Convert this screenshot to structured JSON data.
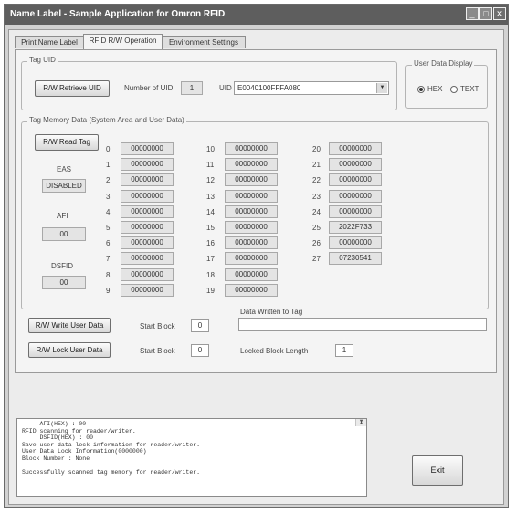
{
  "window": {
    "title": "Name Label - Sample Application for Omron RFID",
    "minimize": "_",
    "maximize": "□",
    "close": "✕"
  },
  "tabs": [
    "Print Name Label",
    "RFID R/W Operation",
    "Environment Settings"
  ],
  "tag_uid": {
    "group_title": "Tag UID",
    "retrieve_button": "R/W Retrieve UID",
    "number_of_uid_label": "Number of UID",
    "number_of_uid": "1",
    "uid_label": "UID",
    "uid_value": "E0040100FFFA080",
    "dropdown_arrow": "▼"
  },
  "display": {
    "group_title": "User Data Display",
    "options": [
      "HEX",
      "TEXT"
    ],
    "selected": "HEX"
  },
  "memory": {
    "group_title": "Tag Memory Data (System Area and User Data)",
    "read_button": "R/W Read Tag",
    "eas_label": "EAS",
    "eas_value": "DISABLED",
    "afi_label": "AFI",
    "afi_value": "00",
    "dsfid_label": "DSFID",
    "dsfid_value": "00",
    "blocks": [
      {
        "n": "0",
        "v": "00000000"
      },
      {
        "n": "1",
        "v": "00000000"
      },
      {
        "n": "2",
        "v": "00000000"
      },
      {
        "n": "3",
        "v": "00000000"
      },
      {
        "n": "4",
        "v": "00000000"
      },
      {
        "n": "5",
        "v": "00000000"
      },
      {
        "n": "6",
        "v": "00000000"
      },
      {
        "n": "7",
        "v": "00000000"
      },
      {
        "n": "8",
        "v": "00000000"
      },
      {
        "n": "9",
        "v": "00000000"
      },
      {
        "n": "10",
        "v": "00000000"
      },
      {
        "n": "11",
        "v": "00000000"
      },
      {
        "n": "12",
        "v": "00000000"
      },
      {
        "n": "13",
        "v": "00000000"
      },
      {
        "n": "14",
        "v": "00000000"
      },
      {
        "n": "15",
        "v": "00000000"
      },
      {
        "n": "16",
        "v": "00000000"
      },
      {
        "n": "17",
        "v": "00000000"
      },
      {
        "n": "18",
        "v": "00000000"
      },
      {
        "n": "19",
        "v": "00000000"
      },
      {
        "n": "20",
        "v": "00000000"
      },
      {
        "n": "21",
        "v": "00000000"
      },
      {
        "n": "22",
        "v": "00000000"
      },
      {
        "n": "23",
        "v": "00000000"
      },
      {
        "n": "24",
        "v": "00000000"
      },
      {
        "n": "25",
        "v": "2022F733"
      },
      {
        "n": "26",
        "v": "00000000"
      },
      {
        "n": "27",
        "v": "07230541"
      }
    ]
  },
  "write": {
    "write_button": "R/W Write User Data",
    "start_block_label": "Start Block",
    "start_block": "0",
    "data_label": "Data Written to Tag",
    "data_value": ""
  },
  "lock": {
    "lock_button": "R/W Lock User Data",
    "start_block_label": "Start Block",
    "start_block": "0",
    "length_label": "Locked Block Length",
    "length": "1"
  },
  "log": {
    "lines": [
      "     AFI(HEX) : 00",
      "RFID scanning for reader/writer.",
      "     DSFID(HEX) : 00",
      "Save user data lock information for reader/writer.",
      "User Data Lock Information(0000000)",
      "Block Number : None",
      "",
      "Successfully scanned tag memory for reader/writer."
    ],
    "scroll_up": "▲",
    "scroll_down": "▼"
  },
  "exit_button": "Exit"
}
